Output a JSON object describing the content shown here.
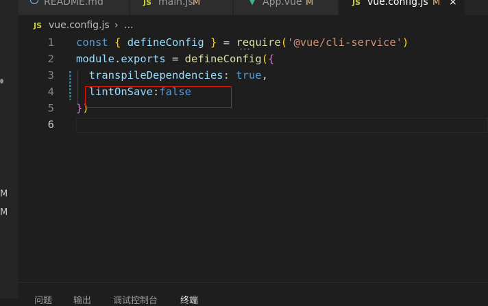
{
  "tabs": [
    {
      "label": "README.md",
      "modified": "",
      "icon": "info-icon"
    },
    {
      "label": "main.js",
      "modified": "M",
      "icon": "js-file-icon"
    },
    {
      "label": "App.vue",
      "modified": "M",
      "icon": "vue-file-icon"
    },
    {
      "label": "vue.config.js",
      "modified": "M",
      "icon": "js-file-icon",
      "active": true,
      "close": "×"
    }
  ],
  "file_icon_text": "JS",
  "breadcrumb": {
    "file": "vue.config.js",
    "separator": "›",
    "more": "..."
  },
  "left_strip": {
    "badges": [
      "M",
      "M"
    ]
  },
  "editor": {
    "line_numbers": [
      "1",
      "2",
      "3",
      "4",
      "5",
      "6"
    ],
    "line1": {
      "kw": "const",
      "b1": "{",
      "name": " defineConfig ",
      "b2": "}",
      "eq": " = ",
      "fn": "require",
      "p1": "(",
      "str": "'@vue/cli-service'",
      "p2": ")"
    },
    "line2": {
      "var1": "module",
      "dot": ".",
      "var2": "exports",
      "eq": " = ",
      "fn": "defineConfig",
      "p1": "(",
      "b1": "{"
    },
    "line3": {
      "indent": "  ",
      "key": "transpileDependencies",
      "colon": ": ",
      "val": "true",
      "comma": ","
    },
    "line4": {
      "indent": "  ",
      "key": "lintOnSave",
      "colon": ":",
      "val": "false"
    },
    "line5": {
      "b": "}",
      "p": ")"
    }
  },
  "panel": {
    "tabs": [
      "问题",
      "输出",
      "调试控制台",
      "终端"
    ]
  },
  "colors": {
    "highlight_box": "#e51400",
    "keyword": "#569cd6",
    "string": "#ce9178"
  }
}
